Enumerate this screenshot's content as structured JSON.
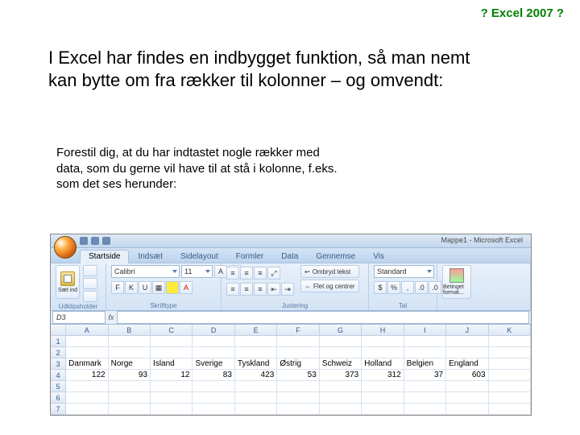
{
  "header": {
    "title": "? Excel 2007 ?"
  },
  "intro": "I Excel har findes en indbygget funktion, så man nemt kan bytte om fra rækker til kolonner – og omvendt:",
  "para": "Forestil dig, at du har indtastet nogle rækker med data, som du gerne vil have til at stå i kolonne, f.eks. som det ses herunder:",
  "excel": {
    "window_title": "Mappe1 - Microsoft Excel",
    "tabs": [
      "Startside",
      "Indsæt",
      "Sidelayout",
      "Formler",
      "Data",
      "Gennemse",
      "Vis"
    ],
    "active_tab": 0,
    "clipboard": {
      "paste": "Sæt ind",
      "label": "Udklipsholder"
    },
    "font": {
      "name": "Calibri",
      "size": "11",
      "bold": "F",
      "italic": "K",
      "underline": "U",
      "label": "Skrifttype"
    },
    "alignment": {
      "wrap": "Ombryd tekst",
      "merge": "Flet og centrer",
      "label": "Justering"
    },
    "number": {
      "format": "Standard",
      "label": "Tal"
    },
    "styles": {
      "cond": "Betinget format...",
      "label": ""
    },
    "namebox": "D3",
    "columns": [
      "A",
      "B",
      "C",
      "D",
      "E",
      "F",
      "G",
      "H",
      "I",
      "J",
      "K"
    ],
    "rows": [
      {
        "h": "1",
        "cells": [
          "",
          "",
          "",
          "",
          "",
          "",
          "",
          "",
          "",
          "",
          ""
        ]
      },
      {
        "h": "2",
        "cells": [
          "",
          "",
          "",
          "",
          "",
          "",
          "",
          "",
          "",
          "",
          ""
        ]
      },
      {
        "h": "3",
        "cells": [
          "Danmark",
          "Norge",
          "Island",
          "Sverige",
          "Tyskland",
          "Østrig",
          "Schweiz",
          "Holland",
          "Belgien",
          "England",
          ""
        ],
        "align": "l"
      },
      {
        "h": "4",
        "cells": [
          "122",
          "93",
          "12",
          "83",
          "423",
          "53",
          "373",
          "312",
          "37",
          "603",
          ""
        ],
        "align": "r"
      },
      {
        "h": "5",
        "cells": [
          "",
          "",
          "",
          "",
          "",
          "",
          "",
          "",
          "",
          "",
          ""
        ]
      },
      {
        "h": "6",
        "cells": [
          "",
          "",
          "",
          "",
          "",
          "",
          "",
          "",
          "",
          "",
          ""
        ]
      },
      {
        "h": "7",
        "cells": [
          "",
          "",
          "",
          "",
          "",
          "",
          "",
          "",
          "",
          "",
          ""
        ]
      }
    ]
  }
}
